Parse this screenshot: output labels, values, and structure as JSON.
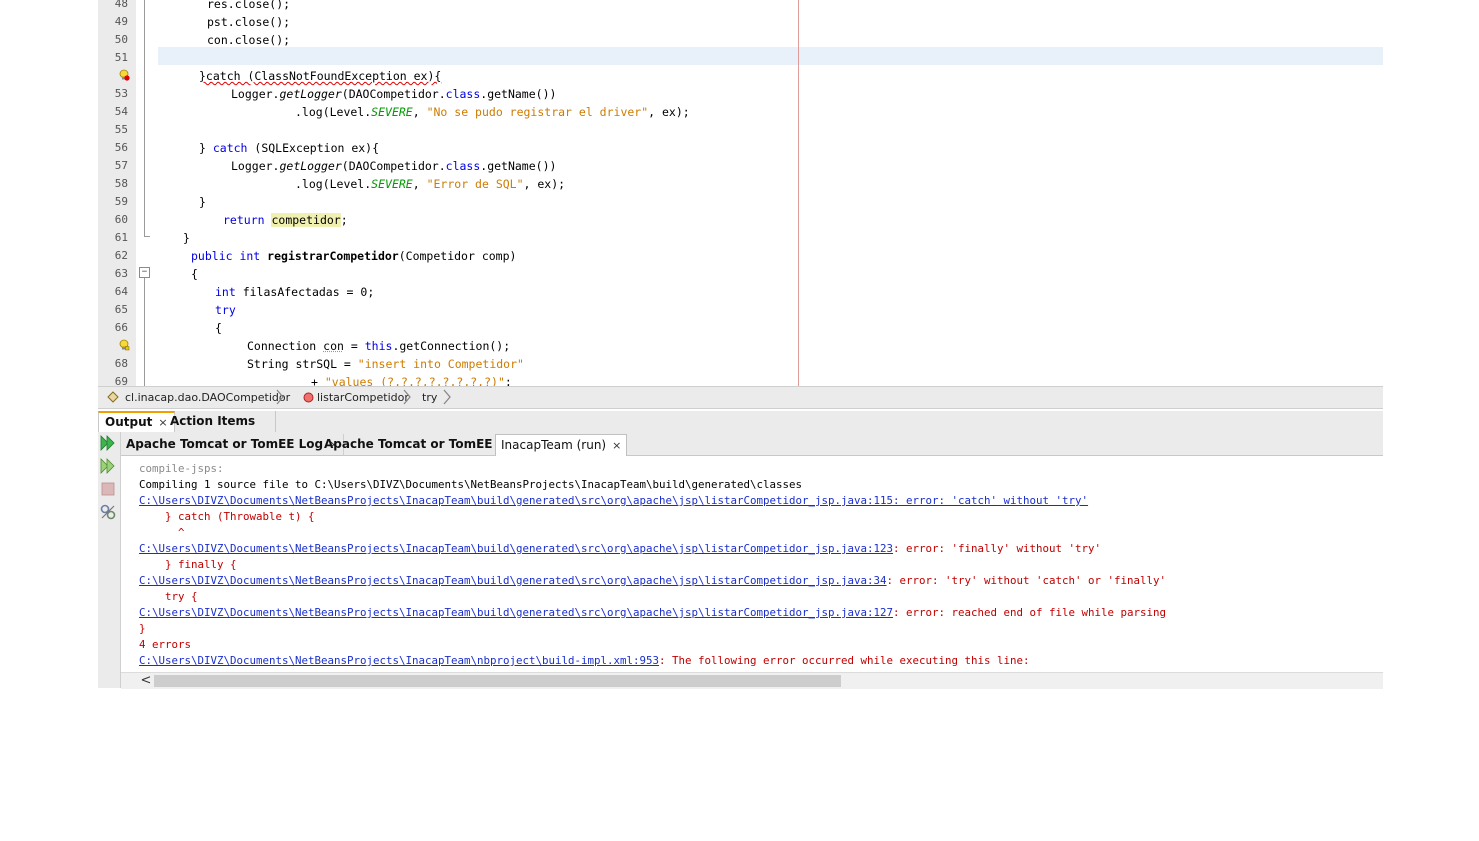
{
  "editor": {
    "lines": [
      {
        "n": "48"
      },
      {
        "n": "49"
      },
      {
        "n": "50"
      },
      {
        "n": "51"
      },
      {
        "n": ""
      },
      {
        "n": "53"
      },
      {
        "n": "54"
      },
      {
        "n": "55"
      },
      {
        "n": "56"
      },
      {
        "n": "57"
      },
      {
        "n": "58"
      },
      {
        "n": "59"
      },
      {
        "n": "60"
      },
      {
        "n": "61"
      },
      {
        "n": "62"
      },
      {
        "n": "63"
      },
      {
        "n": "64"
      },
      {
        "n": "65"
      },
      {
        "n": "66"
      },
      {
        "n": ""
      },
      {
        "n": "68"
      },
      {
        "n": "69"
      }
    ],
    "code": {
      "l48": "res.close();",
      "l49": "pst.close();",
      "l50": "con.close();",
      "l52_a": "}catch (ClassNotFoundException ex){",
      "l53_a": "Logger.",
      "l53_b": "getLogger",
      "l53_c": "(DAOCompetidor.",
      "l53_d": "class",
      "l53_e": ".getName())",
      "l54_a": ".log(Level.",
      "l54_b": "SEVERE",
      "l54_c": ", ",
      "l54_d": "\"No se pudo registrar el driver\"",
      "l54_e": ", ex);",
      "l56_a": "} ",
      "l56_b": "catch",
      "l56_c": " (SQLException ex){",
      "l57_a": "Logger.",
      "l57_b": "getLogger",
      "l57_c": "(DAOCompetidor.",
      "l57_d": "class",
      "l57_e": ".getName())",
      "l58_a": ".log(Level.",
      "l58_b": "SEVERE",
      "l58_c": ", ",
      "l58_d": "\"Error de SQL\"",
      "l58_e": ", ex);",
      "l59": "}",
      "l60_a": "return",
      "l60_b": " ",
      "l60_c": "competidor",
      "l60_d": ";",
      "l61": "}",
      "l62_a": "public int",
      "l62_b": " registrarCompetidor",
      "l62_c": "(Competidor comp)",
      "l63": "{",
      "l64_a": "int",
      "l64_b": " filasAfectadas = 0;",
      "l65": "try",
      "l66": "{",
      "l67_a": "Connection ",
      "l67_b": "con",
      "l67_c": " = ",
      "l67_d": "this",
      "l67_e": ".getConnection();",
      "l68_a": "String strSQL = ",
      "l68_b": "\"insert into Competidor\"",
      "l69_a": "+ ",
      "l69_b": "\"values (?,?,?,?,?,?,?,?)\"",
      "l69_c": ";"
    }
  },
  "breadcrumb": {
    "items": [
      "cl.inacap.dao.DAOCompetidor",
      "listarCompetidor",
      "try"
    ]
  },
  "panel": {
    "tabs": [
      "Output",
      "Action Items"
    ],
    "close": "×"
  },
  "output_tabs": {
    "items": [
      "Apache Tomcat or TomEE Log",
      "Apache Tomcat or TomEE",
      "InacapTeam (run)"
    ],
    "close": "×"
  },
  "console": {
    "l0": "-",
    "l1": "compile-jsps:",
    "l2": "Compiling 1 source file to C:\\Users\\DIVZ\\Documents\\NetBeansProjects\\InacapTeam\\build\\generated\\classes",
    "l3_link": "C:\\Users\\DIVZ\\Documents\\NetBeansProjects\\InacapTeam\\build\\generated\\src\\org\\apache\\jsp\\listarCompetidor_jsp.java:115: error: 'catch' without 'try'",
    "l4": "    } catch (Throwable t) {",
    "l5": "      ^",
    "l6_link": "C:\\Users\\DIVZ\\Documents\\NetBeansProjects\\InacapTeam\\build\\generated\\src\\org\\apache\\jsp\\listarCompetidor_jsp.java:123",
    "l6_msg": ": error: 'finally' without 'try'",
    "l7": "    } finally {",
    "l8_link": "C:\\Users\\DIVZ\\Documents\\NetBeansProjects\\InacapTeam\\build\\generated\\src\\org\\apache\\jsp\\listarCompetidor_jsp.java:34",
    "l8_msg": ": error: 'try' without 'catch' or 'finally'",
    "l9": "    try {",
    "l10_link": "C:\\Users\\DIVZ\\Documents\\NetBeansProjects\\InacapTeam\\build\\generated\\src\\org\\apache\\jsp\\listarCompetidor_jsp.java:127",
    "l10_msg": ": error: reached end of file while parsing",
    "l11": "}",
    "l12": "4 errors",
    "l13_link": "C:\\Users\\DIVZ\\Documents\\NetBeansProjects\\InacapTeam\\nbproject\\build-impl.xml:953",
    "l13_msg": ": The following error occurred while executing this line:"
  },
  "scroll": {
    "left_arrow": "<"
  },
  "colors": {
    "keyword": "#0000e6",
    "string": "#ce7b00",
    "constant": "#009900",
    "error": "#c00000",
    "link": "#1a2ecb",
    "accent": "#f0a000"
  }
}
